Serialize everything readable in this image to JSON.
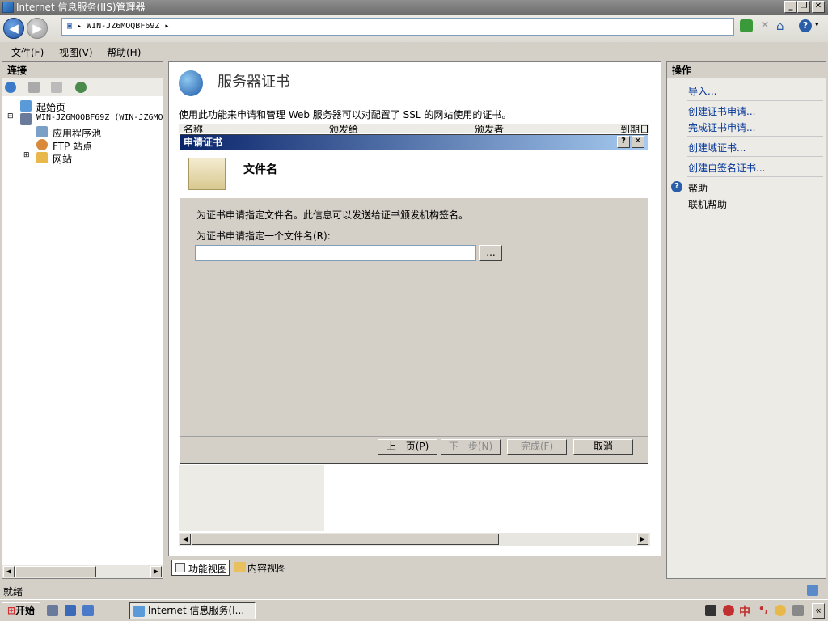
{
  "window": {
    "title": "Internet 信息服务(IIS)管理器"
  },
  "address": {
    "path": "WIN-JZ6MOQBF69Z"
  },
  "menu": {
    "file": "文件(F)",
    "view": "视图(V)",
    "help": "帮助(H)"
  },
  "connections": {
    "title": "连接",
    "tree": {
      "start": "起始页",
      "server": "WIN-JZ6MOQBF69Z (WIN-JZ6MO",
      "apppools": "应用程序池",
      "ftp": "FTP 站点",
      "sites": "网站"
    }
  },
  "main": {
    "title": "服务器证书",
    "description": "使用此功能来申请和管理 Web 服务器可以对配置了 SSL 的网站使用的证书。",
    "columns": [
      "名称",
      "颁发给",
      "颁发者",
      "到期日"
    ]
  },
  "dialog": {
    "title": "申请证书",
    "heading": "文件名",
    "info": "为证书申请指定文件名。此信息可以发送给证书颁发机构签名。",
    "field_label": "为证书申请指定一个文件名(R):",
    "field_value": "",
    "browse": "...",
    "prev": "上一页(P)",
    "next": "下一步(N)",
    "finish": "完成(F)",
    "cancel": "取消"
  },
  "views": {
    "feature": "功能视图",
    "content": "内容视图"
  },
  "actions": {
    "title": "操作",
    "import": "导入...",
    "create_request": "创建证书申请...",
    "complete_request": "完成证书申请...",
    "create_domain": "创建域证书...",
    "create_selfsigned": "创建自签名证书...",
    "help": "帮助",
    "online_help": "联机帮助"
  },
  "status": {
    "text": "就绪"
  },
  "taskbar": {
    "start": "开始",
    "task": "Internet 信息服务(I...",
    "ime": "中"
  }
}
